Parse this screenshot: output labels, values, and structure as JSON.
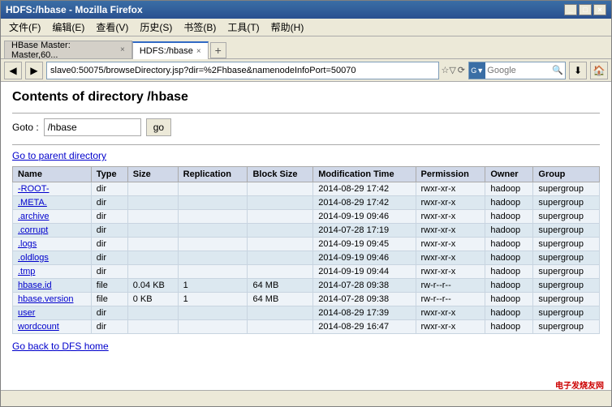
{
  "window": {
    "title": "HDFS:/hbase - Mozilla Firefox",
    "buttons": {
      "minimize": "_",
      "restore": "□",
      "close": "×"
    }
  },
  "menu": {
    "items": [
      {
        "label": "文件(F)"
      },
      {
        "label": "编辑(E)"
      },
      {
        "label": "查看(V)"
      },
      {
        "label": "历史(S)"
      },
      {
        "label": "书签(B)"
      },
      {
        "label": "工具(T)"
      },
      {
        "label": "帮助(H)"
      }
    ]
  },
  "tabs": [
    {
      "label": "HBase Master: Master,60...",
      "active": false
    },
    {
      "label": "HDFS:/hbase",
      "active": true
    }
  ],
  "nav": {
    "address": "slave0:50075/browseDirectory.jsp?dir=%2Fhbase&namenodeInfoPort=50070",
    "search_placeholder": "Google"
  },
  "page": {
    "title": "Contents of directory /hbase",
    "goto_label": "Goto :",
    "goto_value": "/hbase",
    "goto_btn": "go",
    "parent_link": "Go to parent directory",
    "dfs_link": "Go back to DFS home"
  },
  "table": {
    "headers": [
      "Name",
      "Type",
      "Size",
      "Replication",
      "Block Size",
      "Modification Time",
      "Permission",
      "Owner",
      "Group"
    ],
    "rows": [
      {
        "name": "-ROOT-",
        "type": "dir",
        "size": "",
        "replication": "",
        "block_size": "",
        "mod_time": "2014-08-29  17:42",
        "permission": "rwxr-xr-x",
        "owner": "hadoop",
        "group": "supergroup"
      },
      {
        "name": ".META.",
        "type": "dir",
        "size": "",
        "replication": "",
        "block_size": "",
        "mod_time": "2014-08-29  17:42",
        "permission": "rwxr-xr-x",
        "owner": "hadoop",
        "group": "supergroup"
      },
      {
        "name": ".archive",
        "type": "dir",
        "size": "",
        "replication": "",
        "block_size": "",
        "mod_time": "2014-09-19  09:46",
        "permission": "rwxr-xr-x",
        "owner": "hadoop",
        "group": "supergroup"
      },
      {
        "name": ".corrupt",
        "type": "dir",
        "size": "",
        "replication": "",
        "block_size": "",
        "mod_time": "2014-07-28  17:19",
        "permission": "rwxr-xr-x",
        "owner": "hadoop",
        "group": "supergroup"
      },
      {
        "name": ".logs",
        "type": "dir",
        "size": "",
        "replication": "",
        "block_size": "",
        "mod_time": "2014-09-19  09:45",
        "permission": "rwxr-xr-x",
        "owner": "hadoop",
        "group": "supergroup"
      },
      {
        "name": ".oldlogs",
        "type": "dir",
        "size": "",
        "replication": "",
        "block_size": "",
        "mod_time": "2014-09-19  09:46",
        "permission": "rwxr-xr-x",
        "owner": "hadoop",
        "group": "supergroup"
      },
      {
        "name": ".tmp",
        "type": "dir",
        "size": "",
        "replication": "",
        "block_size": "",
        "mod_time": "2014-09-19  09:44",
        "permission": "rwxr-xr-x",
        "owner": "hadoop",
        "group": "supergroup"
      },
      {
        "name": "hbase.id",
        "type": "file",
        "size": "0.04 KB",
        "replication": "1",
        "block_size": "64 MB",
        "mod_time": "2014-07-28  09:38",
        "permission": "rw-r--r--",
        "owner": "hadoop",
        "group": "supergroup"
      },
      {
        "name": "hbase.version",
        "type": "file",
        "size": "0 KB",
        "replication": "1",
        "block_size": "64 MB",
        "mod_time": "2014-07-28  09:38",
        "permission": "rw-r--r--",
        "owner": "hadoop",
        "group": "supergroup"
      },
      {
        "name": "user",
        "type": "dir",
        "size": "",
        "replication": "",
        "block_size": "",
        "mod_time": "2014-08-29  17:39",
        "permission": "rwxr-xr-x",
        "owner": "hadoop",
        "group": "supergroup"
      },
      {
        "name": "wordcount",
        "type": "dir",
        "size": "",
        "replication": "",
        "block_size": "",
        "mod_time": "2014-08-29  16:47",
        "permission": "rwxr-xr-x",
        "owner": "hadoop",
        "group": "supergroup"
      }
    ]
  },
  "watermark": "电子发烧友网"
}
